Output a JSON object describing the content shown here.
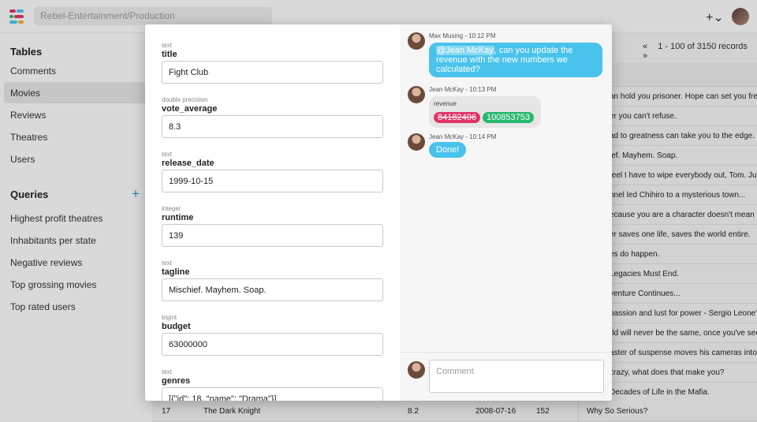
{
  "header": {
    "breadcrumb": "Rebel-Entertainment/Production",
    "add_label": "+⌄"
  },
  "sidebar": {
    "tables_heading": "Tables",
    "tables": [
      {
        "label": "Comments"
      },
      {
        "label": "Movies"
      },
      {
        "label": "Reviews"
      },
      {
        "label": "Theatres"
      },
      {
        "label": "Users"
      }
    ],
    "active_table": "Movies",
    "queries_heading": "Queries",
    "add_query_label": "+",
    "queries": [
      {
        "label": "Highest profit theatres"
      },
      {
        "label": "Inhabitants per state"
      },
      {
        "label": "Negative reviews"
      },
      {
        "label": "Top grossing movies"
      },
      {
        "label": "Top rated users"
      }
    ]
  },
  "pager": {
    "first": "«",
    "range": "1 - 100 of 3150 records",
    "next": "»"
  },
  "table_rows": [
    {
      "tagline": "an hold you prisoner. Hope can set you free"
    },
    {
      "tagline": "er you can't refuse."
    },
    {
      "tagline": "ad to greatness can take you to the edge."
    },
    {
      "tagline": "ief. Mayhem. Soap."
    },
    {
      "tagline": "feel I have to wipe everybody out, Tom. Just"
    },
    {
      "tagline": "nnel led Chihiro to a mysterious town..."
    },
    {
      "tagline": "ecause you are a character doesn't mean you"
    },
    {
      "tagline": "er saves one life, saves the world entire."
    },
    {
      "tagline": "es do happen."
    },
    {
      "tagline": "Legacies Must End."
    },
    {
      "tagline": "venture Continues..."
    },
    {
      "tagline": "passion and lust for power - Sergio Leone's"
    },
    {
      "tagline": "rld will never be the same, once you've seen"
    },
    {
      "tagline": "aster of suspense moves his cameras into the"
    },
    {
      "tagline": "crazy, what does that make you?"
    },
    {
      "tagline": "Decades of Life in the Mafia."
    }
  ],
  "last_row": {
    "id": "17",
    "title": "The Dark Knight",
    "vote": "8.2",
    "date": "2008-07-16",
    "runtime": "152",
    "tagline": "Why So Serious?"
  },
  "form": {
    "fields": [
      {
        "type": "text",
        "name": "title",
        "value": "Fight Club"
      },
      {
        "type": "double precision",
        "name": "vote_average",
        "value": "8.3"
      },
      {
        "type": "text",
        "name": "release_date",
        "value": "1999-10-15"
      },
      {
        "type": "integer",
        "name": "runtime",
        "value": "139"
      },
      {
        "type": "text",
        "name": "tagline",
        "value": "Mischief. Mayhem. Soap."
      },
      {
        "type": "bigint",
        "name": "budget",
        "value": "63000000"
      },
      {
        "type": "text",
        "name": "genres",
        "value": "[{\"id\": 18, \"name\": \"Drama\"}]"
      }
    ]
  },
  "chat": {
    "messages": [
      {
        "author_time": "Max Musing - 10:12 PM",
        "mention": "@Jean McKay",
        "text": ", can you update the revenue with the new numbers we calculated?"
      },
      {
        "author_time": "Jean McKay - 10:13 PM",
        "diff_field": "revenue",
        "old_value": "84182406",
        "new_value": "100853753"
      },
      {
        "author_time": "Jean McKay - 10:14 PM",
        "text": "Done!"
      }
    ],
    "comment_placeholder": "Comment"
  },
  "colors": {
    "accent": "#4ac3ec",
    "old_value": "#e03565",
    "new_value": "#27b76e",
    "add_query": "#2d8fd5"
  }
}
